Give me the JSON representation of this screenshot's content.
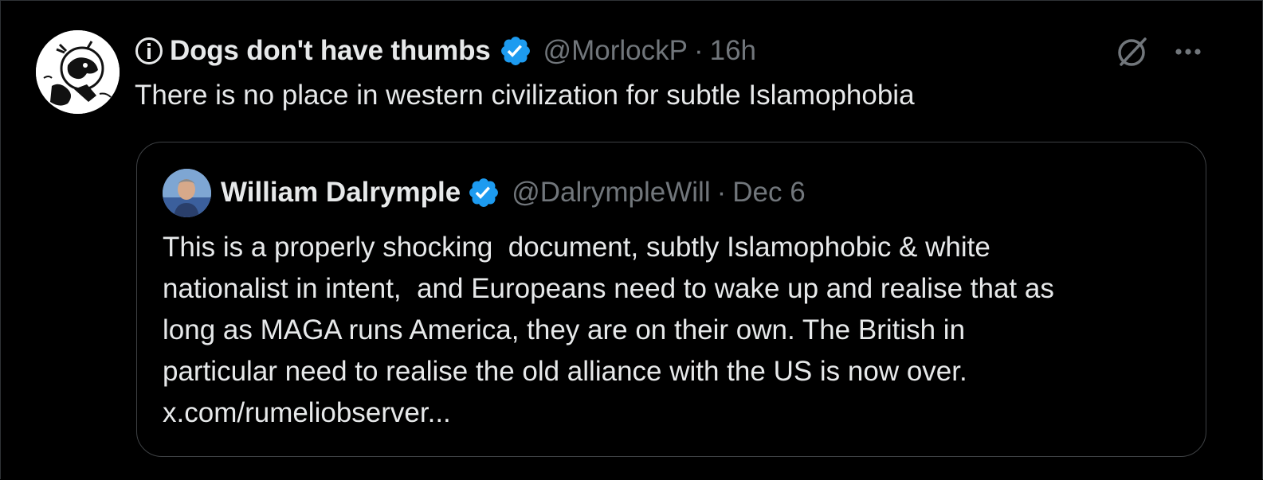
{
  "tweet": {
    "author": {
      "display_name": "Dogs don't have thumbs",
      "handle": "@MorlockP",
      "verified": true,
      "avatar_icon": "dog-sketch-avatar",
      "prefix_icon": "info-circle-icon"
    },
    "separator": "·",
    "timestamp": "16h",
    "text": "There is no place in western civilization for subtle Islamophobia",
    "actions": {
      "grok_icon": "grok-icon",
      "more_icon": "more-horizontal-icon"
    }
  },
  "quoted_tweet": {
    "author": {
      "display_name": "William Dalrymple",
      "handle": "@DalrympleWill",
      "verified": true,
      "avatar_icon": "profile-photo-avatar"
    },
    "separator": "·",
    "timestamp": "Dec 6",
    "lines": [
      "This is a properly shocking  document, subtly Islamophobic & white",
      "nationalist in intent,  and Europeans need to wake up and realise that as",
      "long as MAGA runs America, they are on their own. The British in",
      "particular need to realise the old alliance with the US is now over.",
      "x.com/rumeliobserver..."
    ]
  },
  "colors": {
    "background": "#000000",
    "text_primary": "#e7e9ea",
    "text_muted": "#71767b",
    "verified_blue": "#1d9bf0",
    "border": "#2f3336"
  }
}
